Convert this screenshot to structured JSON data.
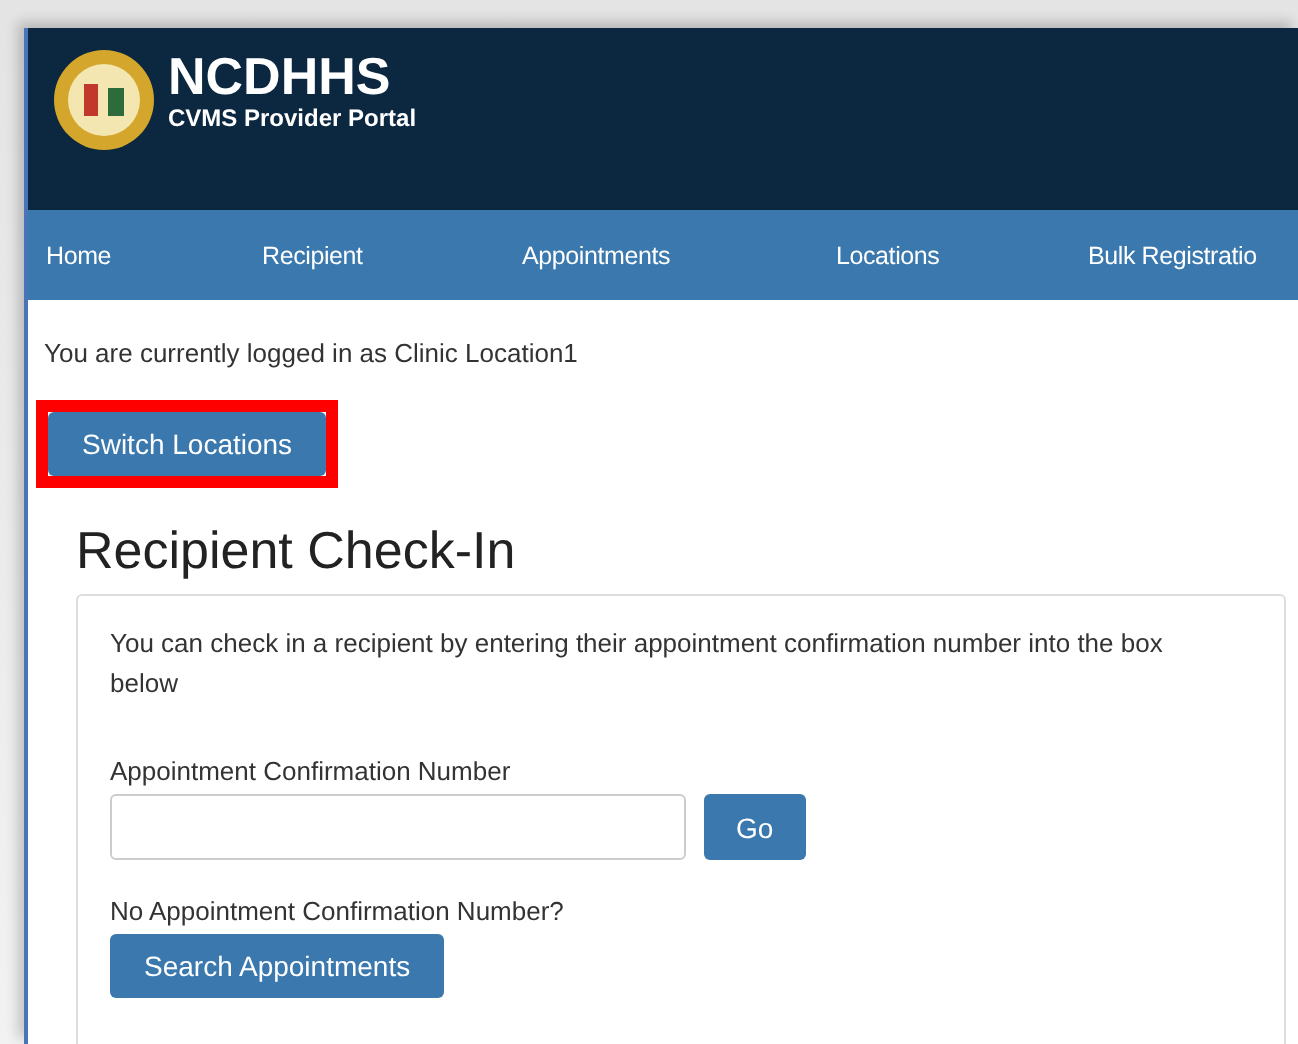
{
  "header": {
    "title": "NCDHHS",
    "subtitle": "CVMS Provider Portal"
  },
  "nav": [
    {
      "label": "Home"
    },
    {
      "label": "Recipient"
    },
    {
      "label": "Appointments"
    },
    {
      "label": "Locations"
    },
    {
      "label": "Bulk Registratio"
    }
  ],
  "login_status": "You are currently logged in as Clinic Location1",
  "switch_button": {
    "label": "Switch Locations",
    "highlighted": true
  },
  "page_title": "Recipient Check-In",
  "card": {
    "intro": "You can check in a recipient by entering their appointment confirmation number into the box below",
    "field_label": "Appointment Confirmation Number",
    "go_button": "Go",
    "no_number_label": "No Appointment Confirmation Number?",
    "search_button": "Search Appointments"
  }
}
